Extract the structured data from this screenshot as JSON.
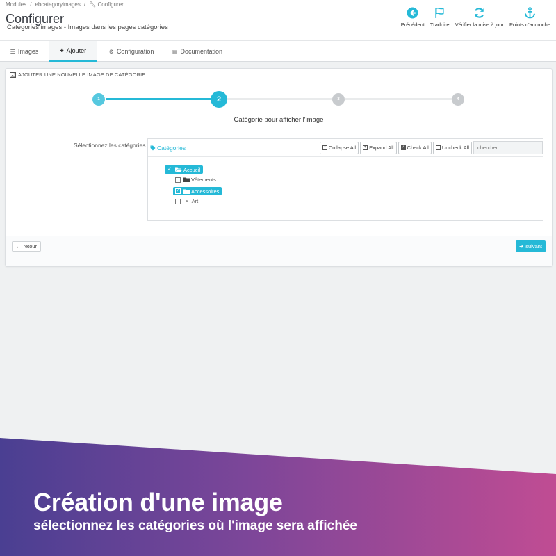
{
  "breadcrumb": {
    "items": [
      "Modules",
      "ebcategoryimages",
      "Configurer"
    ]
  },
  "header": {
    "title": "Configurer",
    "subtitle": "Catégories images - Images dans les pages catégories"
  },
  "toolbar": [
    {
      "label": "Précédent",
      "icon": "back-circle-icon"
    },
    {
      "label": "Traduire",
      "icon": "flag-icon"
    },
    {
      "label": "Vérifier la mise à jour",
      "icon": "refresh-icon"
    },
    {
      "label": "Points d'accroche",
      "icon": "anchor-icon"
    }
  ],
  "tabs": [
    {
      "label": "Images",
      "icon": "list-icon",
      "active": false
    },
    {
      "label": "Ajouter",
      "icon": "plus-icon",
      "active": true
    },
    {
      "label": "Configuration",
      "icon": "cogs-icon",
      "active": false
    },
    {
      "label": "Documentation",
      "icon": "file-icon",
      "active": false
    }
  ],
  "panel": {
    "heading": "AJOUTER UNE NOUVELLE IMAGE DE CATÉGORIE",
    "steps": [
      "1",
      "2",
      "3",
      "4"
    ],
    "current_step": 2,
    "step_title": "Catégorie pour afficher l'image",
    "field_label": "Sélectionnez les catégories",
    "tree": {
      "title": "Catégories",
      "buttons": {
        "collapse": "Collapse All",
        "expand": "Expand All",
        "check": "Check All",
        "uncheck": "Uncheck All"
      },
      "search_placeholder": "chercher...",
      "nodes": [
        {
          "label": "Accueil",
          "checked": true
        },
        {
          "label": "Vêtements",
          "checked": false
        },
        {
          "label": "Accessoires",
          "checked": true
        },
        {
          "label": "Art",
          "checked": false
        }
      ]
    },
    "back_label": "retour",
    "next_label": "suivant"
  },
  "banner": {
    "title": "Création d'une image",
    "subtitle": "sélectionnez les catégories où l'image sera affichée"
  },
  "colors": {
    "accent": "#25b9d7",
    "banner_left": "#4a3f92",
    "banner_right": "#c04c93"
  }
}
